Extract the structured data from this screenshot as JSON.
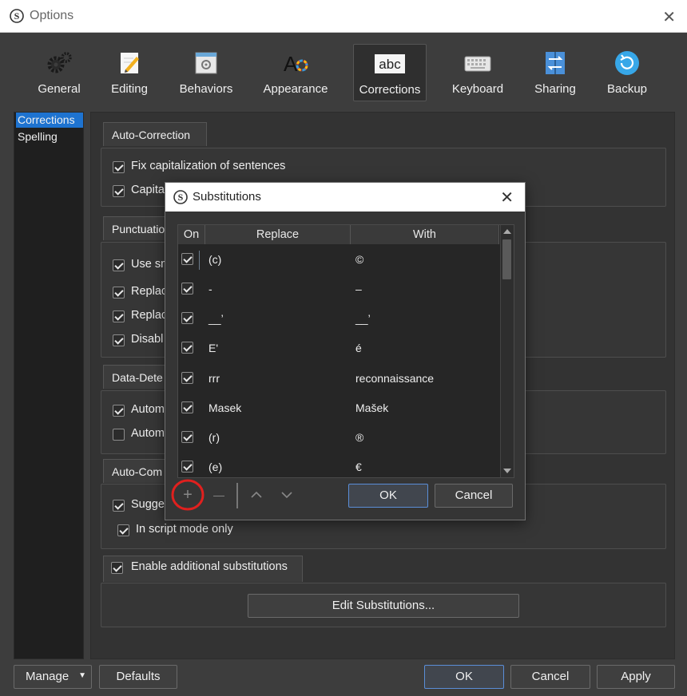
{
  "window": {
    "title": "Options"
  },
  "toolbar": {
    "items": [
      {
        "label": "General",
        "icon": "gears-icon"
      },
      {
        "label": "Editing",
        "icon": "pencil-page-icon"
      },
      {
        "label": "Behaviors",
        "icon": "behaviors-window-icon"
      },
      {
        "label": "Appearance",
        "icon": "appearance-color-icon"
      },
      {
        "label": "Corrections",
        "icon": "abc-icon"
      },
      {
        "label": "Keyboard",
        "icon": "keyboard-icon"
      },
      {
        "label": "Sharing",
        "icon": "sharing-arrows-icon"
      },
      {
        "label": "Backup",
        "icon": "backup-refresh-icon"
      }
    ],
    "selected": "Corrections"
  },
  "sidebar": {
    "items": [
      {
        "label": "Corrections"
      },
      {
        "label": "Spelling"
      }
    ],
    "selected": "Corrections"
  },
  "sections": {
    "auto_correction": {
      "tab": "Auto-Correction",
      "options": [
        {
          "label": "Fix capitalization of sentences",
          "checked": true
        },
        {
          "label": "Capita",
          "checked": true
        }
      ]
    },
    "punctuation": {
      "tab": "Punctuatio",
      "options": [
        {
          "label": "Use sm",
          "checked": true
        },
        {
          "label": "Replac",
          "checked": true
        },
        {
          "label": "Replac",
          "checked": true
        },
        {
          "label": "Disabl",
          "checked": true
        }
      ]
    },
    "data_detection": {
      "tab": "Data-Dete",
      "options": [
        {
          "label": "Autom",
          "checked": true
        },
        {
          "label": "Autom",
          "checked": false
        }
      ]
    },
    "auto_completion": {
      "tab": "Auto-Com",
      "options": [
        {
          "label": "Sugge",
          "checked": true
        },
        {
          "label": "In script mode only",
          "checked": true
        }
      ]
    },
    "additional": {
      "tab_label": "Enable additional substitutions",
      "checked": true,
      "edit_button": "Edit Substitutions..."
    }
  },
  "footer": {
    "manage": "Manage",
    "defaults": "Defaults",
    "ok": "OK",
    "cancel": "Cancel",
    "apply": "Apply"
  },
  "dialog": {
    "title": "Substitutions",
    "columns": [
      "On",
      "Replace",
      "With"
    ],
    "rows": [
      {
        "on": true,
        "replace": "(c)",
        "with": "©"
      },
      {
        "on": true,
        "replace": " -",
        "with": " –"
      },
      {
        "on": true,
        "replace": "__’",
        "with": "__’"
      },
      {
        "on": true,
        "replace": "E'",
        "with": "é"
      },
      {
        "on": true,
        "replace": "rrr",
        "with": "reconnaissance"
      },
      {
        "on": true,
        "replace": "Masek",
        "with": "Mašek"
      },
      {
        "on": true,
        "replace": "(r)",
        "with": "®"
      },
      {
        "on": true,
        "replace": "(e)",
        "with": "€"
      }
    ],
    "add_symbol": "+",
    "remove_symbol": "—",
    "ok": "OK",
    "cancel": "Cancel"
  },
  "colors": {
    "accent": "#1e73d0",
    "highlight_circle": "#e0201e",
    "primary_button_border": "#5a8ed8"
  }
}
